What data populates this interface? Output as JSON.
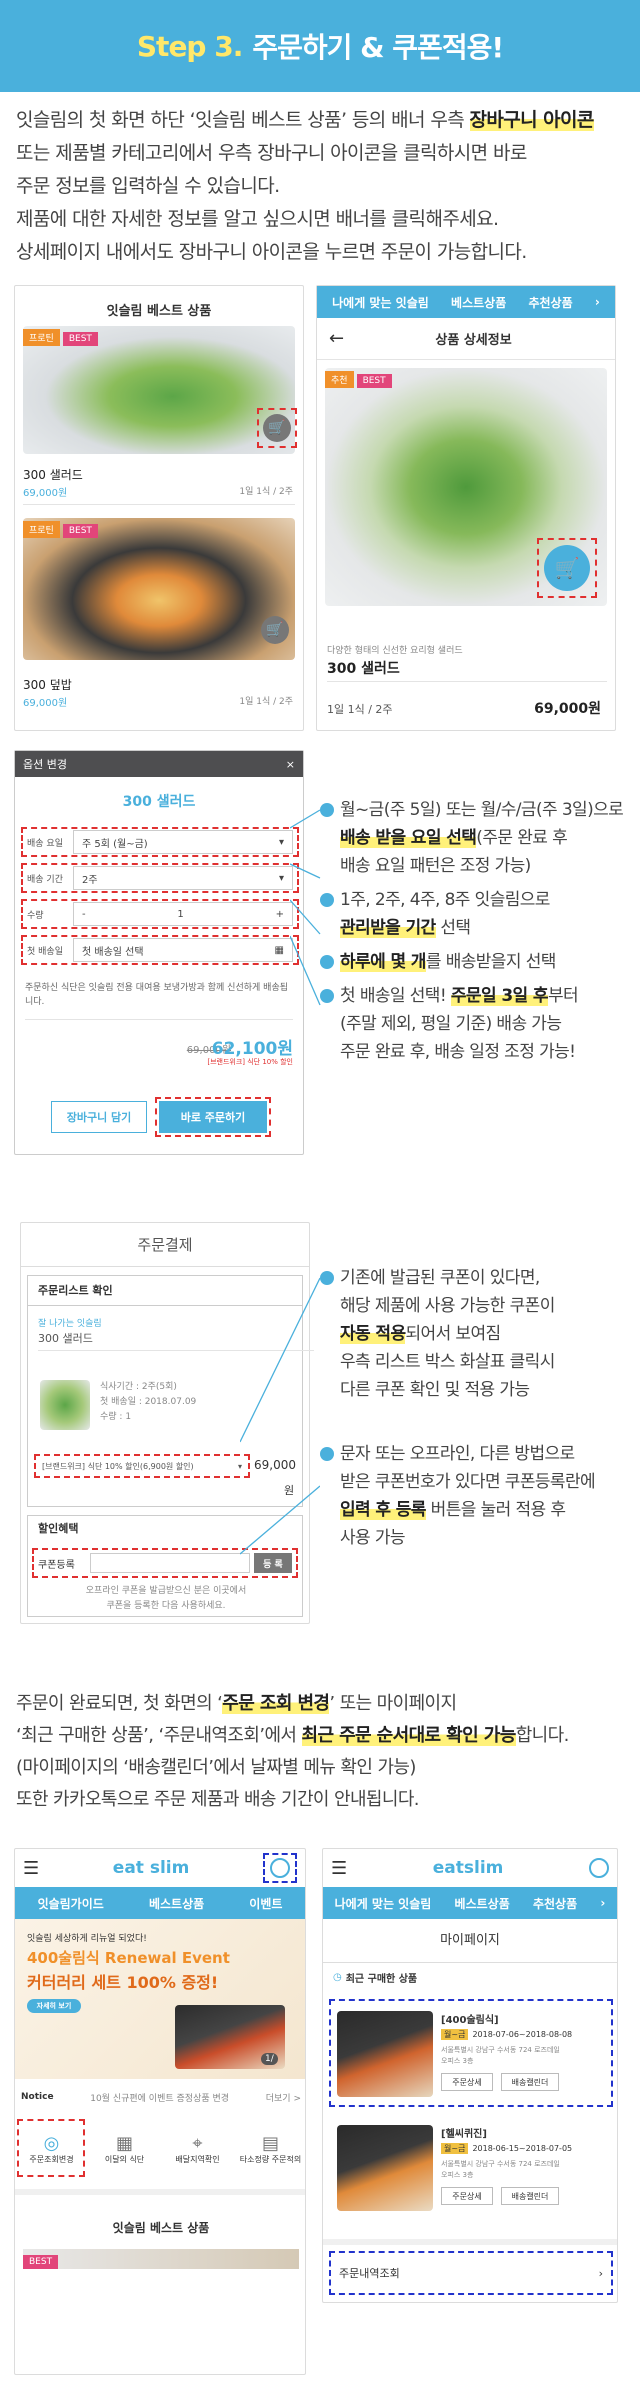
{
  "header": {
    "step": "Step 3.",
    "title": "주문하기 & 쿠폰적용!"
  },
  "intro": {
    "l1a": "잇슬림의 첫 화면 하단 ‘잇슬림 베스트 상품’ 등의 배너 우측 ",
    "l1b": "장바구니 아이콘",
    "l2": "또는 제품별 카테고리에서 우측 장바구니 아이콘을 클릭하시면 바로",
    "l3": "주문 정보를 입력하실 수 있습니다.",
    "l4": "제품에 대한 자세한 정보를 알고 싶으시면 배너를 클릭해주세요.",
    "l5": "상세페이지 내에서도 장바구니 아이콘을 누르면 주문이 가능합니다."
  },
  "best": {
    "title": "잇슬림 베스트 상품",
    "badge1": "프로틴",
    "badge2": "BEST",
    "item1": {
      "name": "300 샐러드",
      "price": "69,000원",
      "meta": "1일 1식 / 2주"
    },
    "item2": {
      "name": "300 덮밥",
      "price": "69,000원",
      "meta": "1일 1식 / 2주"
    }
  },
  "detail": {
    "tabs": [
      "나에게 맞는 잇슬림",
      "베스트상품",
      "추천상품"
    ],
    "title": "상품 상세정보",
    "badge1": "추천",
    "badge2": "BEST",
    "desc": "다양한 형태의 신선한 요리형 샐러드",
    "name": "300 샐러드",
    "meta": "1일 1식 / 2주",
    "price": "69,000원"
  },
  "option": {
    "header": "옵션 변경",
    "product": "300 샐러드",
    "rows": [
      {
        "label": "배송 요일",
        "value": "주 5회 (월~금)"
      },
      {
        "label": "배송 기간",
        "value": "2주"
      },
      {
        "label": "수량",
        "value": "1"
      },
      {
        "label": "첫 배송일",
        "value": "첫 배송일 선택"
      }
    ],
    "desc": "주문하신 식단은 잇슬림 전용 대여용 보냉가방과 함께 신선하게 배송됩니다.",
    "old_price": "69,000원",
    "price": "62,100원",
    "discount": "[브랜드위크] 식단 10% 할인",
    "btn_cart": "장바구니 담기",
    "btn_order": "바로 주문하기"
  },
  "notes1": [
    {
      "t1": "월~금(주 5일) 또는 월/수/금(주 3일)으로",
      "b": "배송 받을 요일 선택",
      "t2": "(주문 완료 후",
      "t3": "배송 요일 패턴은 조정 가능)"
    },
    {
      "t1": "1주, 2주, 4주, 8주 잇슬림으로",
      "b": "관리받을 기간",
      "t2": " 선택"
    },
    {
      "b": "하루에 몇 개",
      "t2": "를 배송받을지 선택"
    },
    {
      "t1": "첫 배송일 선택! ",
      "b": "주문일 3일 후",
      "t2": "부터",
      "t3": "(주말 제외, 평일 기준) 배송 가능",
      "t4": "주문 완료 후, 배송 일정 조정 가능!"
    }
  ],
  "payment": {
    "header": "주문결제",
    "list_title": "주문리스트 확인",
    "category": "잘 나가는 잇슬림",
    "product": "300 샐러드",
    "period": "식사기간 : 2주(5회)",
    "first": "첫 배송일 : 2018.07.09",
    "qty": "수량 : 1",
    "coupon_line": "[브랜드위크] 식단 10% 할인(6,900원 할인)",
    "price": "69,000",
    "unit": "원",
    "discount_title": "할인혜택",
    "coupon_label": "쿠폰등록",
    "register": "등 록",
    "hint1": "오프라인 쿠폰을 발급받으신 분은 이곳에서",
    "hint2": "쿠폰을 등록한 다음 사용하세요."
  },
  "notes2": [
    {
      "t1": "기존에 발급된 쿠폰이 있다면,",
      "t2": "해당 제품에 사용 가능한 쿠폰이",
      "b": "자동 적용",
      "t3": "되어서 보여짐",
      "t4": "우측 리스트 박스 화살표 클릭시",
      "t5": "다른 쿠폰 확인 및 적용 가능"
    },
    {
      "t1": "문자 또는 오프라인, 다른 방법으로",
      "t2": "받은 쿠폰번호가 있다면 쿠폰등록란에",
      "b": "입력 후 등록",
      "t3": " 버튼을 눌러 적용 후",
      "t4": "사용 가능"
    }
  ],
  "outro": {
    "l1a": "주문이 완료되면, 첫 화면의 ‘",
    "l1b": "주문 조회 변경",
    "l1c": "’ 또는 마이페이지",
    "l2a": "‘최근 구매한 상품’, ‘주문내역조회’에서 ",
    "l2b": "최근 주문 순서대로 확인 가능",
    "l2c": "합니다.",
    "l3": "(마이페이지의 ‘배송캘린더’에서 날짜별 메뉴 확인 가능)",
    "l4": "또한 카카오톡으로 주문 제품과 배송 기간이 안내됩니다."
  },
  "home": {
    "logo": "eat slim",
    "tabs": [
      "잇슬림가이드",
      "베스트상품",
      "이벤트"
    ],
    "banner_small": "잇슬림 세상하게 리뉴얼 되었다!",
    "banner_l1": "400술림식 Renewal Event",
    "banner_l2": "커터러리 세트 100% 증정!",
    "banner_btn": "자세히 보기",
    "page": "1/",
    "notice_label": "Notice",
    "notice_text": "10월 신규편에 이벤트 증정상품 변경",
    "notice_more": "더보기 >",
    "menu": [
      "주문조회변경",
      "이달의 식단",
      "배달지역확인",
      "타소정량 주문적의"
    ],
    "best": "잇슬림 베스트 상품",
    "best_badge": "BEST"
  },
  "mypage": {
    "logo": "eatslim",
    "tabs": [
      "나에게 맞는 잇슬림",
      "베스트상품",
      "추천상품"
    ],
    "title": "마이페이지",
    "recent": "최근 구매한 상품",
    "items": [
      {
        "name": "[400술림식]",
        "tag": "월~금",
        "date": "2018-07-06~2018-08-08",
        "addr1": "서울특별시 강남구 수서동 724 로즈데일",
        "addr2": "오피스 3층",
        "b1": "주문상세",
        "b2": "배송캘린더"
      },
      {
        "name": "[헬씨퀴진]",
        "tag": "월~금",
        "date": "2018-06-15~2018-07-05",
        "addr1": "서울특별시 강남구 수서동 724 로즈데일",
        "addr2": "오피스 3층",
        "b1": "주문상세",
        "b2": "배송캘린더"
      }
    ],
    "orders": "주문내역조회"
  },
  "colors": {
    "accent": "#4ab0dc",
    "highlight": "#fff17a",
    "dash_red": "#e03030",
    "dash_blue": "#2233cc",
    "badge_orange": "#f0902a",
    "badge_pink": "#e2457a"
  }
}
